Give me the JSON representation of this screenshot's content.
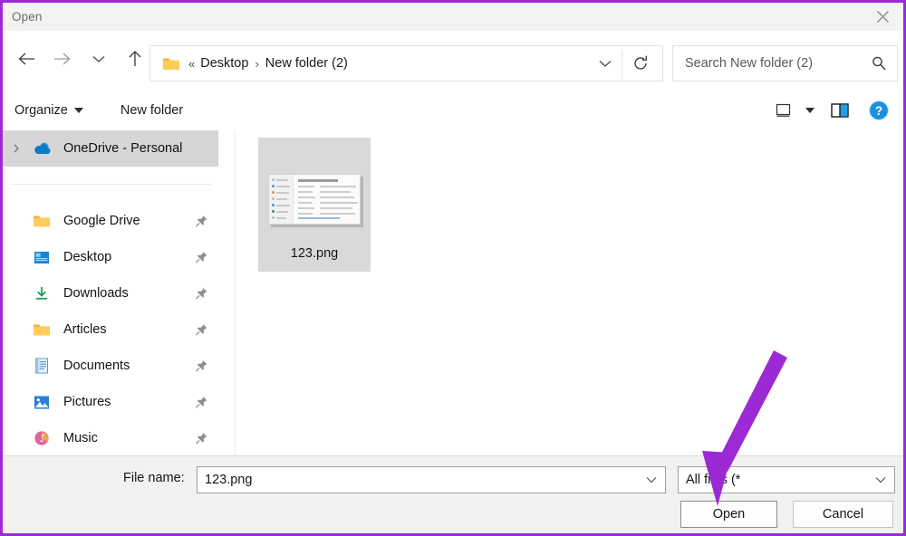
{
  "window": {
    "title": "Open",
    "close_label": "Close",
    "border_color": "#9b2ad4"
  },
  "nav": {
    "back": "Back",
    "forward": "Forward",
    "recent": "Recent locations",
    "up": "Up to Desktop",
    "address": {
      "prefix": "«",
      "crumbs": [
        "Desktop",
        "New folder (2)"
      ],
      "separator": "›",
      "dropdown": "Previous locations",
      "refresh": "Refresh"
    },
    "search": {
      "placeholder": "Search New folder (2)",
      "value": "",
      "icon": "search-icon"
    }
  },
  "toolbar": {
    "organize_label": "Organize",
    "new_folder_label": "New folder",
    "view_label": "Change your view",
    "view_caret_label": "More options",
    "preview_label": "Show the preview pane",
    "help_label": "Get help",
    "help_glyph": "?"
  },
  "sidebar": {
    "items": [
      {
        "label": "OneDrive - Personal",
        "icon": "onedrive-cloud-icon",
        "selected": true,
        "expandable": true,
        "pinned": false
      },
      {
        "label": "Google Drive",
        "icon": "folder-icon",
        "selected": false,
        "expandable": false,
        "pinned": true
      },
      {
        "label": "Desktop",
        "icon": "desktop-icon",
        "selected": false,
        "expandable": false,
        "pinned": true
      },
      {
        "label": "Downloads",
        "icon": "downloads-icon",
        "selected": false,
        "expandable": false,
        "pinned": true
      },
      {
        "label": "Articles",
        "icon": "folder-icon",
        "selected": false,
        "expandable": false,
        "pinned": true
      },
      {
        "label": "Documents",
        "icon": "documents-icon",
        "selected": false,
        "expandable": false,
        "pinned": true
      },
      {
        "label": "Pictures",
        "icon": "pictures-icon",
        "selected": false,
        "expandable": false,
        "pinned": true
      },
      {
        "label": "Music",
        "icon": "music-icon",
        "selected": false,
        "expandable": false,
        "pinned": true
      }
    ],
    "scrollbar": "vertical-scrollbar"
  },
  "files": [
    {
      "name": "123.png",
      "selected": true,
      "icon": "image-thumbnail"
    }
  ],
  "footer": {
    "file_name_label": "File name:",
    "file_name_value": "123.png",
    "file_type_value": "All files (*",
    "open_label": "Open",
    "cancel_label": "Cancel"
  },
  "annotation": {
    "arrow_color": "#9b2ad4",
    "points_to": "Open"
  }
}
